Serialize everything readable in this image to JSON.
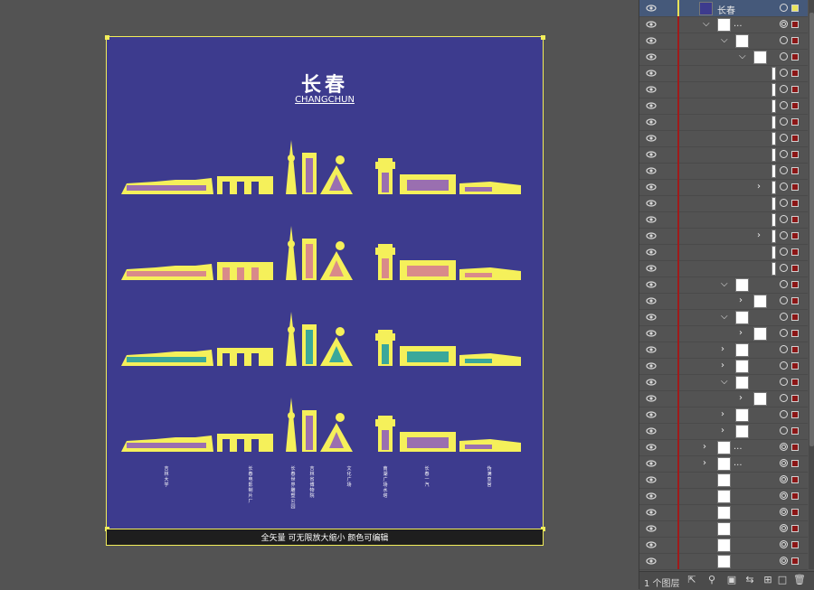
{
  "artboard": {
    "title": "长春",
    "subtitle": "CHANGCHUN",
    "footer_text": "全矢量 可无限放大缩小 颜色可编辑",
    "landmarks": [
      "吉林大学",
      "长春电影制片厂",
      "长春世界雕塑公园",
      "吉林省博物院",
      "文化广场",
      "南湖广场水塔",
      "长春一汽",
      "伪满皇宫"
    ]
  },
  "colors": {
    "artboard_bg": "#3d3b8e",
    "skyline_yellow": "#f5f05a",
    "fill_pink": "#d98a8a",
    "fill_teal": "#3aa89a",
    "fill_purple": "#9a6fb0",
    "layer_color": "#a01a1a",
    "selection": "#45597a"
  },
  "layers_panel": {
    "top_layer_name": "长春",
    "ellipsis": "...",
    "layer_count": "1 个图层",
    "footer_icons": [
      "export-icon",
      "search-icon",
      "clip-icon",
      "move-icon",
      "sublayer-icon",
      "new-layer-icon",
      "trash-icon"
    ]
  }
}
